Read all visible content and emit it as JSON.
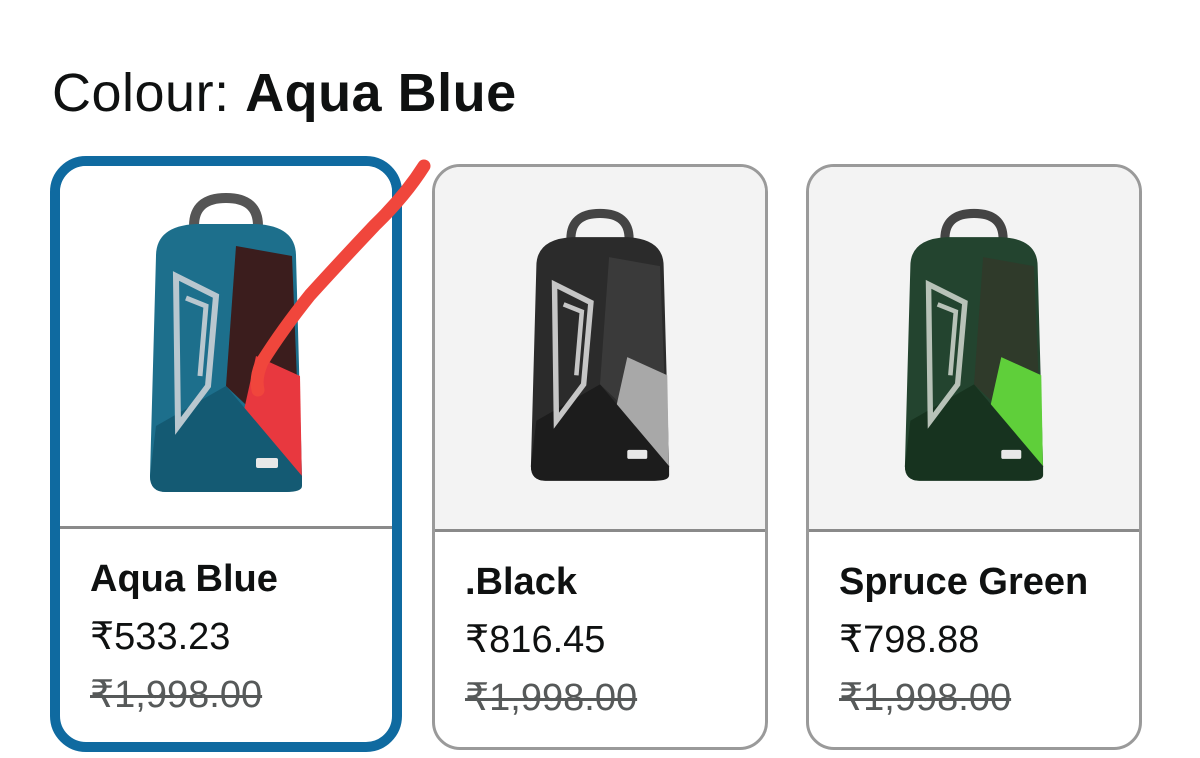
{
  "header": {
    "label": "Colour:",
    "selected_value": "Aqua Blue"
  },
  "variants": [
    {
      "name": "Aqua Blue",
      "price": "₹533.23",
      "mrp": "₹1,998.00",
      "selected": true,
      "colors": {
        "body": "#1d6f8c",
        "dark": "#145a73",
        "mesh": "#3b1d1d",
        "accent": "#e8383f"
      }
    },
    {
      "name": ".Black",
      "price": "₹816.45",
      "mrp": "₹1,998.00",
      "selected": false,
      "colors": {
        "body": "#2b2b2b",
        "dark": "#1c1c1c",
        "mesh": "#3a3a3a",
        "accent": "#a8a8a8"
      }
    },
    {
      "name": "Spruce Green",
      "price": "₹798.88",
      "mrp": "₹1,998.00",
      "selected": false,
      "colors": {
        "body": "#23442f",
        "dark": "#17331f",
        "mesh": "#2f3a2a",
        "accent": "#5fcf3a"
      }
    }
  ],
  "theme": {
    "selected_border": "#0f6aa0",
    "card_border": "#9a9a9a",
    "annotation_stroke": "#f0463c"
  }
}
